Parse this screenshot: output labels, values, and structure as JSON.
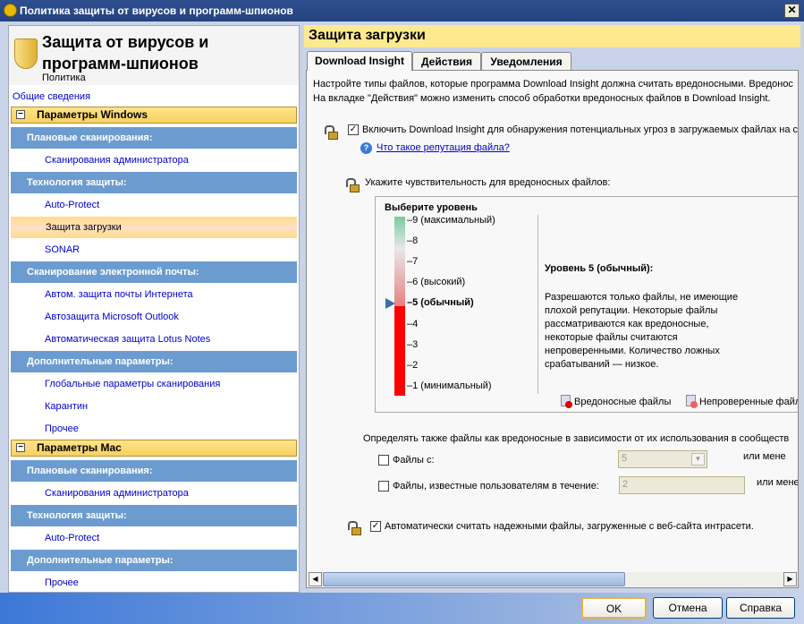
{
  "window": {
    "title": "Политика защиты от вирусов и программ-шпионов",
    "close": "✕"
  },
  "left": {
    "title": "Защита от вирусов и программ-шпионов",
    "title_line1": "Защита от вирусов и",
    "title_line2": "программ-шпионов",
    "subtitle": "Политика",
    "overview": "Общие сведения",
    "windows": {
      "label": "Параметры Windows",
      "sections": [
        {
          "label": "Плановые сканирования:",
          "items": [
            "Сканирования администратора"
          ]
        },
        {
          "label": "Технология защиты:",
          "items": [
            "Auto-Protect",
            "Защита загрузки",
            "SONAR"
          ]
        },
        {
          "label": "Сканирование электронной почты:",
          "items": [
            "Автом. защита почты Интернета",
            "Автозащита Microsoft Outlook",
            "Автоматическая защита Lotus Notes"
          ]
        },
        {
          "label": "Дополнительные параметры:",
          "items": [
            "Глобальные параметры сканирования",
            "Карантин",
            "Прочее"
          ]
        }
      ]
    },
    "mac": {
      "label": "Параметры Mac",
      "sections": [
        {
          "label": "Плановые сканирования:",
          "items": [
            "Сканирования администратора"
          ]
        },
        {
          "label": "Технология защиты:",
          "items": [
            "Auto-Protect"
          ]
        },
        {
          "label": "Дополнительные параметры:",
          "items": [
            "Прочее"
          ]
        }
      ]
    },
    "selected": "Защита загрузки"
  },
  "right": {
    "title": "Защита загрузки",
    "tabs": [
      "Download Insight",
      "Действия",
      "Уведомления"
    ],
    "active_tab": "Download Insight",
    "intro1": "Настройте типы файлов, которые программа Download Insight должна считать вредоносными. Вредонос",
    "intro2": "На вкладке \"Действия\" можно изменить способ обработки вредоносных файлов в Download Insight.",
    "enable_label": "Включить Download Insight для обнаружения потенциальных угроз в загружаемых файлах на с",
    "enable_checked": true,
    "help_link": "Что такое репутация файла?",
    "sensitivity_label": "Укажите чувствительность для вредоносных файлов:",
    "level": {
      "heading": "Выберите уровень",
      "value": 5,
      "ticks": [
        "9 (максимальный)",
        "8",
        "7",
        "6 (высокий)",
        "5 (обычный)",
        "4",
        "3",
        "2",
        "1 (минимальный)"
      ],
      "desc_title": "Уровень 5 (обычный):",
      "desc": [
        "Разрешаются только файлы, не имеющие",
        "плохой репутации. Некоторые файлы",
        "рассматриваются как вредоносные,",
        "некоторые файлы считаются",
        "непроверенными. Количество ложных",
        "срабатываний — низкое."
      ],
      "legend": [
        "Вредоносные файлы",
        "Непроверенные файл"
      ]
    },
    "community_label": "Определять также файлы как вредоносные в зависимости от их использования в сообществ",
    "files_with": {
      "label": "Файлы с:",
      "value": "5",
      "suffix": "или мене",
      "checked": false
    },
    "files_known": {
      "label": "Файлы, известные пользователям в течение:",
      "value": "2",
      "suffix": "или мене",
      "checked": false
    },
    "intranet_label": "Автоматически считать надежными файлы, загруженные с веб-сайта интрасети.",
    "intranet_checked": true
  },
  "buttons": {
    "ok": "OK",
    "cancel": "Отмена",
    "help": "Справка"
  }
}
